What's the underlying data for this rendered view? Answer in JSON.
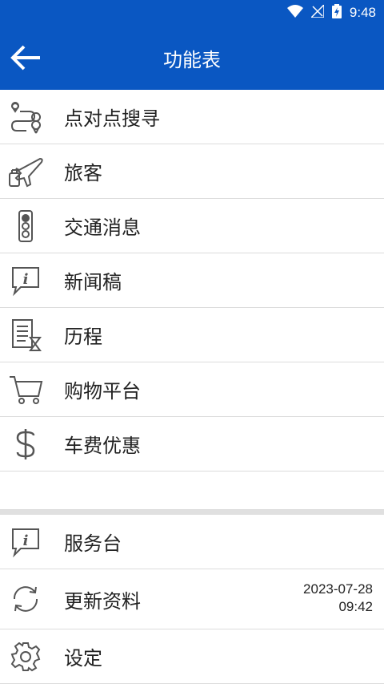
{
  "status_bar": {
    "time": "9:48"
  },
  "app_bar": {
    "title": "功能表"
  },
  "menu": [
    {
      "label": "点对点搜寻",
      "icon": "route-pin-icon"
    },
    {
      "label": "旅客",
      "icon": "airplane-luggage-icon"
    },
    {
      "label": "交通消息",
      "icon": "traffic-light-icon"
    },
    {
      "label": "新闻稿",
      "icon": "info-speech-icon"
    },
    {
      "label": "历程",
      "icon": "history-list-hourglass-icon"
    },
    {
      "label": "购物平台",
      "icon": "shopping-cart-icon"
    },
    {
      "label": "车费优惠",
      "icon": "dollar-icon"
    }
  ],
  "secondary_menu": [
    {
      "label": "服务台",
      "icon": "info-speech-icon"
    },
    {
      "label": "更新资料",
      "icon": "sync-icon",
      "date": "2023-07-28",
      "time": "09:42"
    },
    {
      "label": "设定",
      "icon": "gear-icon"
    }
  ],
  "colors": {
    "primary": "#0a57c2",
    "icon": "#555555",
    "divider": "#dcdcdc"
  }
}
